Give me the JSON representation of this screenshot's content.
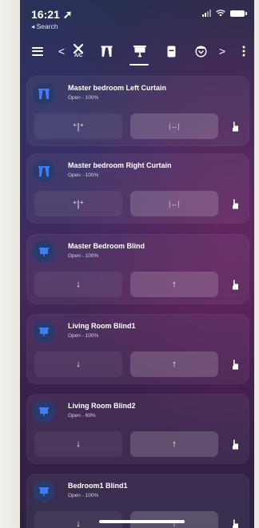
{
  "status_bar": {
    "time": "16:21 ➚",
    "back_label": "◂ Search"
  },
  "toolbar": {
    "prev_label": "<",
    "next_label": ">",
    "ac_label": "A/C",
    "icons": [
      "menu-icon",
      "chevron-left-icon",
      "ac-icon",
      "curtain-icon",
      "blind-icon",
      "lock-icon",
      "security-icon",
      "chevron-right-icon",
      "more-icon"
    ]
  },
  "devices": [
    {
      "name": "Master bedroom Left Curtain",
      "status": "Open - 100%",
      "kind": "curtain",
      "btn_a": "⁺|⁺",
      "btn_b": "|↔|"
    },
    {
      "name": "Master bedroom Right Curtain",
      "status": "Open - 100%",
      "kind": "curtain",
      "btn_a": "⁺|⁺",
      "btn_b": "|↔|"
    },
    {
      "name": "Master Bedroom Blind",
      "status": "Open - 100%",
      "kind": "blind",
      "btn_a": "↓",
      "btn_b": "↑"
    },
    {
      "name": "Living Room Blind1",
      "status": "Open - 100%",
      "kind": "blind",
      "btn_a": "↓",
      "btn_b": "↑"
    },
    {
      "name": "Living Room Blind2",
      "status": "Open - 69%",
      "kind": "blind",
      "btn_a": "↓",
      "btn_b": "↑"
    },
    {
      "name": "Bedroom1 Blind1",
      "status": "Open - 100%",
      "kind": "blind",
      "btn_a": "↓",
      "btn_b": "↑"
    }
  ],
  "colors": {
    "icon_bg": "#2b3a6d",
    "icon_fg": "#3d7ef0"
  }
}
